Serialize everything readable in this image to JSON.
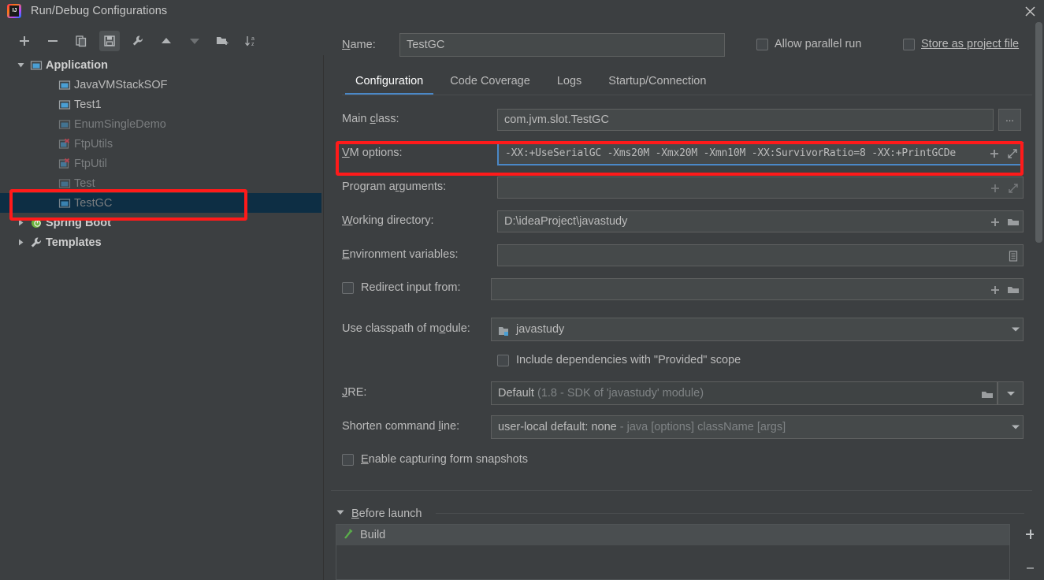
{
  "window": {
    "title": "Run/Debug Configurations",
    "logo_icon": "intellij-idea-logo",
    "close_icon": "close-icon"
  },
  "toolbar": {
    "items": [
      {
        "name": "add-configuration-button",
        "icon": "plus-icon",
        "active": false
      },
      {
        "name": "remove-configuration-button",
        "icon": "minus-icon",
        "active": false
      },
      {
        "name": "copy-configuration-button",
        "icon": "copy-icon",
        "active": false
      },
      {
        "name": "save-configuration-button",
        "icon": "save-floppy-icon",
        "active": true
      },
      {
        "name": "edit-templates-button",
        "icon": "wrench-icon",
        "active": false
      },
      {
        "name": "move-up-button",
        "icon": "arrow-up-icon",
        "active": false
      },
      {
        "name": "move-down-button",
        "icon": "arrow-down-icon",
        "active": false
      },
      {
        "name": "new-folder-button",
        "icon": "folder-add-icon",
        "active": false
      },
      {
        "name": "sort-configurations-button",
        "icon": "sort-az-icon",
        "active": false
      }
    ]
  },
  "sidebar": {
    "items": [
      {
        "label": "Application",
        "type": "group",
        "expanded": true,
        "icon": "application-icon",
        "selected": false,
        "dim": false
      },
      {
        "label": "JavaVMStackSOF",
        "type": "child",
        "icon": "application-icon",
        "selected": false,
        "dim": false
      },
      {
        "label": "Test1",
        "type": "child",
        "icon": "application-icon",
        "selected": false,
        "dim": false
      },
      {
        "label": "EnumSingleDemo",
        "type": "child",
        "icon": "application-icon",
        "selected": false,
        "dim": true
      },
      {
        "label": "FtpUtils",
        "type": "child",
        "icon": "application-error-icon",
        "selected": false,
        "dim": true
      },
      {
        "label": "FtpUtil",
        "type": "child",
        "icon": "application-error-icon",
        "selected": false,
        "dim": true
      },
      {
        "label": "Test",
        "type": "child",
        "icon": "application-icon",
        "selected": false,
        "dim": true
      },
      {
        "label": "TestGC",
        "type": "child",
        "icon": "application-icon",
        "selected": true,
        "dim": true
      },
      {
        "label": "Spring Boot",
        "type": "group",
        "expanded": false,
        "icon": "spring-boot-icon",
        "selected": false,
        "dim": false
      },
      {
        "label": "Templates",
        "type": "group",
        "expanded": false,
        "icon": "wrench-icon",
        "selected": false,
        "dim": false
      }
    ]
  },
  "header": {
    "name_label": "Name:",
    "name_value": "TestGC",
    "allow_parallel_run_label": "Allow parallel run",
    "allow_parallel_run_checked": false,
    "store_as_project_file_label": "Store as project file",
    "store_as_project_file_checked": false,
    "gear_icon": "gear-icon"
  },
  "tabs": [
    {
      "label": "Configuration",
      "active": true
    },
    {
      "label": "Code Coverage",
      "active": false
    },
    {
      "label": "Logs",
      "active": false
    },
    {
      "label": "Startup/Connection",
      "active": false
    }
  ],
  "form": {
    "main_class": {
      "label": "Main class:",
      "value": "com.jvm.slot.TestGC",
      "browse_label": "..."
    },
    "vm_options": {
      "label": "VM options:",
      "value": "-XX:+UseSerialGC -Xms20M -Xmx20M -Xmn10M -XX:SurvivorRatio=8 -XX:+PrintGCDe",
      "focused": true,
      "icons": [
        "plus-icon",
        "expand-icon"
      ]
    },
    "program_arguments": {
      "label": "Program arguments:",
      "value": "",
      "icons": [
        "plus-icon",
        "expand-icon"
      ]
    },
    "working_directory": {
      "label": "Working directory:",
      "value": "D:\\ideaProject\\javastudy",
      "icons": [
        "plus-icon",
        "folder-icon"
      ]
    },
    "environment_variables": {
      "label": "Environment variables:",
      "value": "",
      "icons": [
        "list-edit-icon"
      ]
    },
    "redirect_input": {
      "label": "Redirect input from:",
      "checked": false,
      "value": "",
      "icons": [
        "plus-icon",
        "folder-icon"
      ]
    },
    "classpath_module": {
      "label": "Use classpath of module:",
      "value": "javastudy",
      "icon": "module-folder-icon",
      "dropdown_icon": "chevron-down-icon"
    },
    "include_provided": {
      "label": "Include dependencies with \"Provided\" scope",
      "checked": false
    },
    "jre": {
      "label": "JRE:",
      "value": "Default",
      "hint": "(1.8 - SDK of 'javastudy' module)",
      "icons": [
        "folder-icon",
        "chevron-down-icon"
      ]
    },
    "shorten_command_line": {
      "label": "Shorten command line:",
      "value": "user-local default: none",
      "hint": "- java [options] className [args]",
      "dropdown_icon": "chevron-down-icon"
    },
    "enable_capturing": {
      "label": "Enable capturing form snapshots",
      "checked": false
    }
  },
  "before_launch": {
    "title": "Before launch",
    "expanded": true,
    "items": [
      {
        "label": "Build",
        "icon": "build-hammer-icon"
      }
    ],
    "add_label": "+",
    "remove_label": "−"
  },
  "annotations": {
    "highlight_color": "#ff1a1a",
    "boxes": [
      {
        "name": "tree-selection-highlight",
        "target": "TestGC"
      },
      {
        "name": "vm-options-highlight",
        "target": "VM options:"
      }
    ]
  },
  "colors": {
    "window_bg": "#3c3f41",
    "field_bg": "#45494a",
    "selection_bg": "#0d2e44",
    "accent_blue": "#4a88c7",
    "text": "#bbbbbb",
    "text_dim": "#7a7d7f"
  }
}
